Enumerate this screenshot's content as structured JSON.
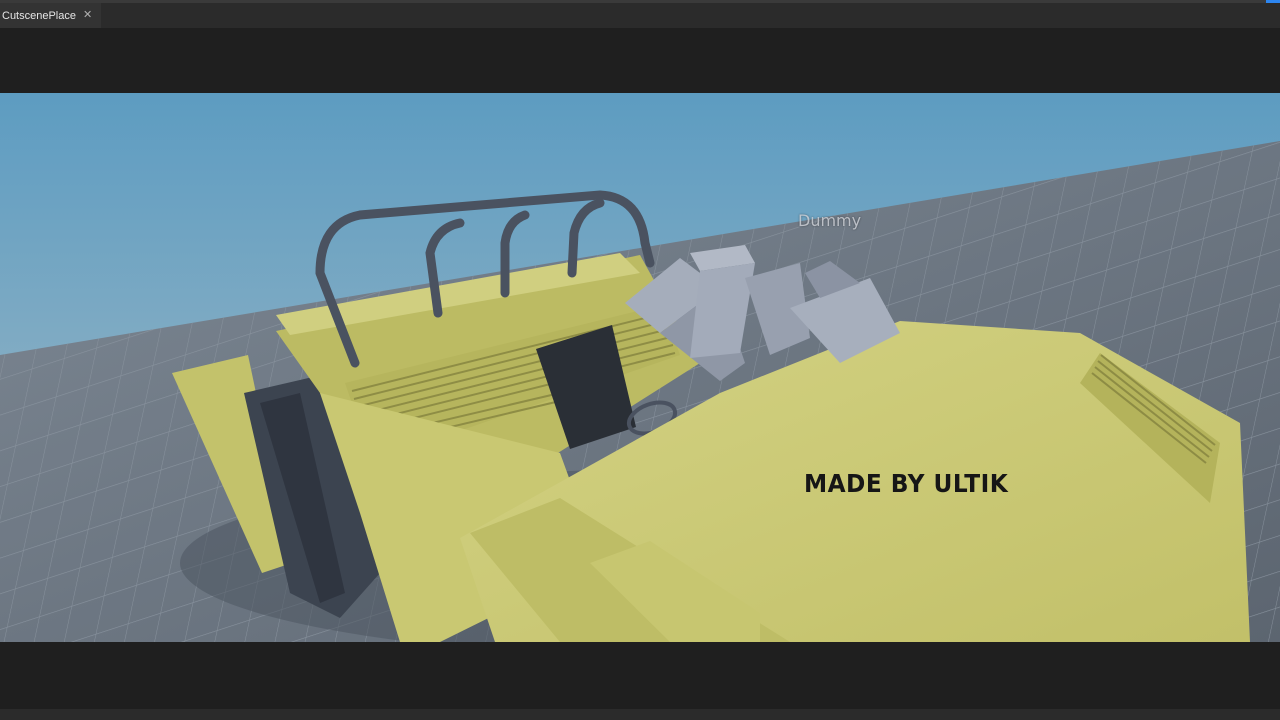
{
  "tabs": [
    {
      "label": "CutscenePlace",
      "close_icon": "close-icon"
    }
  ],
  "viewport": {
    "character_name": "Dummy",
    "overlay_text": "MADE BY ULTIK"
  },
  "colors": {
    "sky_top": "#5f9ec2",
    "sky_horizon": "#9db8c4",
    "baseplate": "#6f7986",
    "vehicle_body": "#c9c872",
    "rollbar": "#4a5260",
    "dummy": "#a3abba",
    "seat": "#2a2f36",
    "tab_accent": "#2d86f0"
  }
}
